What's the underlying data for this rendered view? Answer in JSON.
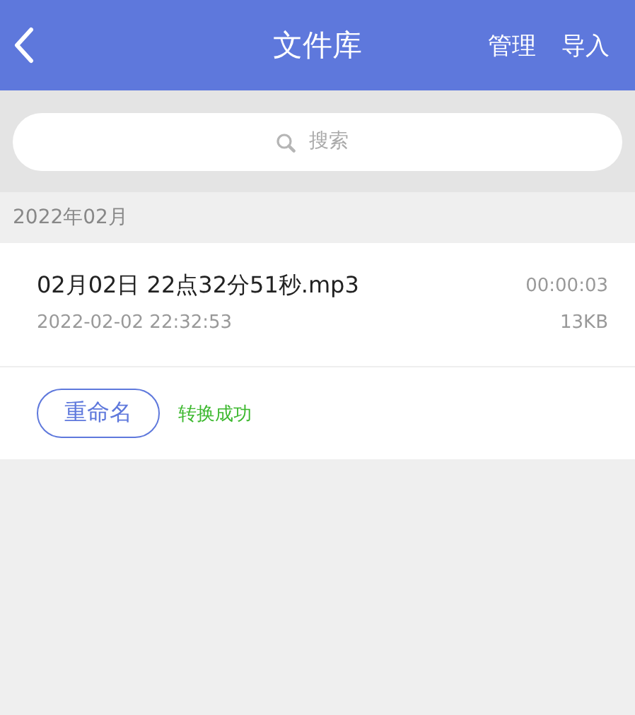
{
  "header": {
    "title": "文件库",
    "actions": [
      "管理",
      "导入"
    ]
  },
  "search": {
    "placeholder": "搜索"
  },
  "groups": [
    {
      "label": "2022年02月",
      "files": [
        {
          "name": "02月02日 22点32分51秒.mp3",
          "duration": "00:00:03",
          "date": "2022-02-02 22:32:53",
          "size": "13KB",
          "action": "重命名",
          "status": "转换成功"
        }
      ]
    }
  ]
}
